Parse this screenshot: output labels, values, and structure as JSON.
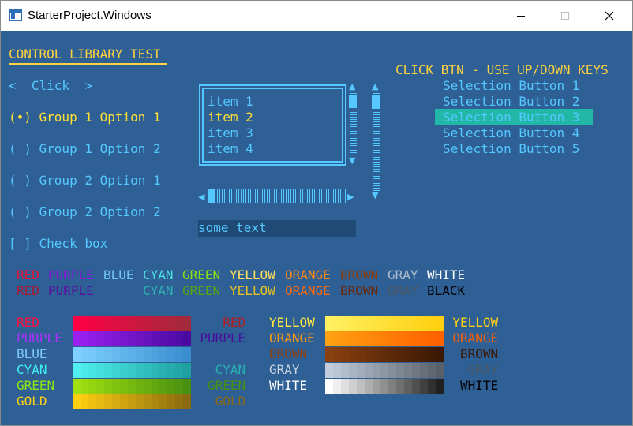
{
  "window": {
    "title": "StarterProject.Windows",
    "minimize_icon": "minimize-icon",
    "maximize_icon": "maximize-icon",
    "close_icon": "close-icon"
  },
  "left": {
    "heading": "CONTROL LIBRARY TEST",
    "click_button": "<  Click  >",
    "radios": [
      "(•) Group 1 Option 1",
      "( ) Group 1 Option 2",
      "( ) Group 2 Option 1",
      "( ) Group 2 Option 2"
    ],
    "checkbox": "[ ] Check box"
  },
  "listbox": {
    "items": [
      "item 1",
      "item 2",
      "item 3",
      "item 4"
    ],
    "selected_index": 1
  },
  "textbox": {
    "value": "some text"
  },
  "right": {
    "heading": "CLICK BTN - USE UP/DOWN KEYS",
    "buttons": [
      "Selection Button 1",
      "Selection Button 2",
      "Selection Button 3",
      "Selection Button 4",
      "Selection Button 5"
    ],
    "selected_index": 2
  },
  "color_names_row1": [
    {
      "label": "RED",
      "color": "#e8102f"
    },
    {
      "label": "PURPLE",
      "color": "#8b10e0"
    },
    {
      "label": "BLUE",
      "color": "#74c6f5"
    },
    {
      "label": "CYAN",
      "color": "#4de0e0"
    },
    {
      "label": "GREEN",
      "color": "#88e012"
    },
    {
      "label": "YELLOW",
      "color": "#ffe25a"
    },
    {
      "label": "ORANGE",
      "color": "#ff8a10"
    },
    {
      "label": "BROWN",
      "color": "#8a3b08"
    },
    {
      "label": "GRAY",
      "color": "#aebccb"
    },
    {
      "label": "WHITE",
      "color": "#ffffff"
    }
  ],
  "color_names_row2": [
    {
      "label": "RED",
      "color": "#a81830"
    },
    {
      "label": "PURPLE",
      "color": "#5a0fa0"
    },
    {
      "label": "CYAN",
      "color": "#2fb3b3"
    },
    {
      "label": "GREEN",
      "color": "#5aa412"
    },
    {
      "label": "YELLOW",
      "color": "#e6c020"
    },
    {
      "label": "ORANGE",
      "color": "#ff6a08"
    },
    {
      "label": "BROWN",
      "color": "#6a2808"
    },
    {
      "label": "GRAY",
      "color": "#4a5866"
    },
    {
      "label": "BLACK",
      "color": "#000000"
    }
  ],
  "ramps_left": [
    {
      "label": "RED",
      "dark_label": "RED",
      "from": "#ff0044",
      "to": "#a02a3a",
      "color": "#ff1040",
      "dark": "#b02020"
    },
    {
      "label": "PURPLE",
      "dark_label": "PURPLE",
      "from": "#9b20f0",
      "to": "#4a0aa0",
      "color": "#b030ff",
      "dark": "#4a0aa0"
    },
    {
      "label": "BLUE",
      "dark_label": "",
      "from": "#7ed0ff",
      "to": "#3a8ed0",
      "color": "#7ecbff",
      "dark": "#3a8ed0"
    },
    {
      "label": "CYAN",
      "dark_label": "CYAN",
      "from": "#50f0f0",
      "to": "#1ea0a0",
      "color": "#40f0f0",
      "dark": "#2ab0b0"
    },
    {
      "label": "GREEN",
      "dark_label": "GREEN",
      "from": "#a0e010",
      "to": "#4a9010",
      "color": "#90e810",
      "dark": "#4a9010"
    },
    {
      "label": "GOLD",
      "dark_label": "GOLD",
      "from": "#ffd010",
      "to": "#8a6a10",
      "color": "#ffd010",
      "dark": "#8a6a10"
    }
  ],
  "ramps_right": [
    {
      "label": "YELLOW",
      "dark_label": "YELLOW",
      "from": "#fff060",
      "to": "#ffd010",
      "color": "#ffe840",
      "dark": "#ffd010"
    },
    {
      "label": "ORANGE",
      "dark_label": "ORANGE",
      "from": "#ffa010",
      "to": "#ff6000",
      "color": "#ff9a10",
      "dark": "#ff6000"
    },
    {
      "label": "BROWN",
      "dark_label": "BROWN",
      "from": "#8a4010",
      "to": "#3a1804",
      "color": "#8a4010",
      "dark": "#3a1804"
    },
    {
      "label": "GRAY",
      "dark_label": "GRAY",
      "from": "#c0ccdc",
      "to": "#5a6068",
      "color": "#c8d4e2",
      "dark": "#4a5866"
    },
    {
      "label": "WHITE",
      "dark_label": "WHITE",
      "from": "#ffffff",
      "to": "#202020",
      "color": "#ffffff",
      "dark": "#000000"
    }
  ]
}
